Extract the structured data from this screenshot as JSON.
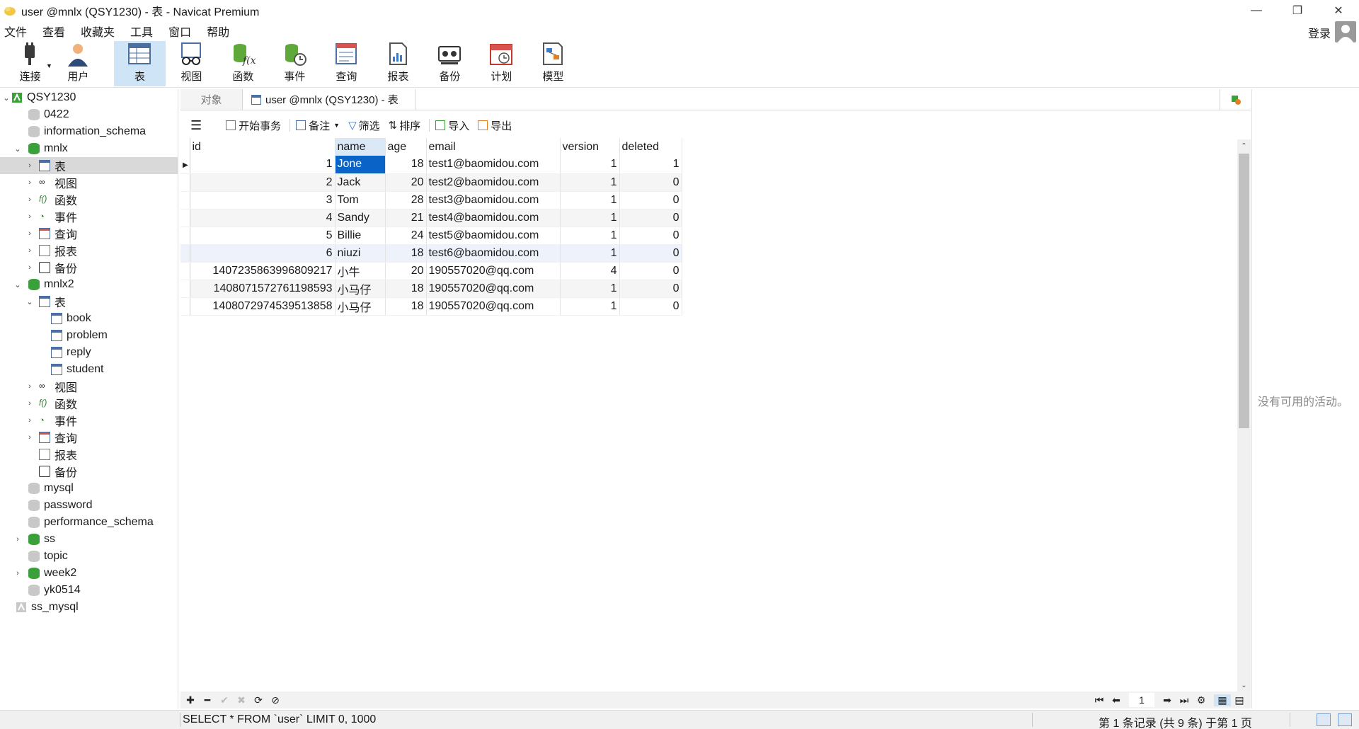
{
  "window": {
    "title": "user @mnlx (QSY1230) - 表 - Navicat Premium",
    "minimize": "—",
    "maximize": "❐",
    "close": "✕"
  },
  "menu": [
    "文件",
    "查看",
    "收藏夹",
    "工具",
    "窗口",
    "帮助"
  ],
  "account": {
    "login": "登录"
  },
  "toolbar": {
    "connect": "连接",
    "user": "用户",
    "table": "表",
    "view": "视图",
    "function": "函数",
    "event": "事件",
    "query": "查询",
    "report": "报表",
    "backup": "备份",
    "schedule": "计划",
    "model": "模型"
  },
  "tree": {
    "connection": "QSY1230",
    "db_0422": "0422",
    "db_information_schema": "information_schema",
    "db_mnlx": "mnlx",
    "mnlx_tables": "表",
    "mnlx_views": "视图",
    "mnlx_functions": "函数",
    "mnlx_events": "事件",
    "mnlx_queries": "查询",
    "mnlx_reports": "报表",
    "mnlx_backups": "备份",
    "db_mnlx2": "mnlx2",
    "mnlx2_tables": "表",
    "t_book": "book",
    "t_problem": "problem",
    "t_reply": "reply",
    "t_student": "student",
    "mnlx2_views": "视图",
    "mnlx2_functions": "函数",
    "mnlx2_events": "事件",
    "mnlx2_queries": "查询",
    "mnlx2_reports": "报表",
    "mnlx2_backups": "备份",
    "db_mysql": "mysql",
    "db_password": "password",
    "db_performance_schema": "performance_schema",
    "db_ss": "ss",
    "db_topic": "topic",
    "db_week2": "week2",
    "db_yk0514": "yk0514",
    "connection2": "ss_mysql"
  },
  "tabs": {
    "objects": "对象",
    "active": "user @mnlx (QSY1230) - 表"
  },
  "data_toolbar": {
    "begin_tx": "开始事务",
    "note": "备注",
    "filter": "筛选",
    "sort": "排序",
    "import": "导入",
    "export": "导出"
  },
  "grid": {
    "columns": [
      "id",
      "name",
      "age",
      "email",
      "version",
      "deleted"
    ],
    "rows": [
      [
        "1",
        "Jone",
        "18",
        "test1@baomidou.com",
        "1",
        "1"
      ],
      [
        "2",
        "Jack",
        "20",
        "test2@baomidou.com",
        "1",
        "0"
      ],
      [
        "3",
        "Tom",
        "28",
        "test3@baomidou.com",
        "1",
        "0"
      ],
      [
        "4",
        "Sandy",
        "21",
        "test4@baomidou.com",
        "1",
        "0"
      ],
      [
        "5",
        "Billie",
        "24",
        "test5@baomidou.com",
        "1",
        "0"
      ],
      [
        "6",
        "niuzi",
        "18",
        "test6@baomidou.com",
        "1",
        "0"
      ],
      [
        "1407235863996809217",
        "小牛",
        "20",
        "190557020@qq.com",
        "4",
        "0"
      ],
      [
        "1408071572761198593",
        "小马仔",
        "18",
        "190557020@qq.com",
        "1",
        "0"
      ],
      [
        "1408072974539513858",
        "小马仔",
        "18",
        "190557020@qq.com",
        "1",
        "0"
      ]
    ]
  },
  "info_panel": {
    "text": "没有可用的活动。"
  },
  "pager": {
    "page": "1"
  },
  "status": {
    "sql": "SELECT * FROM `user` LIMIT 0, 1000",
    "records": "第 1 条记录 (共 9 条) 于第 1 页"
  },
  "colors": {
    "accent": "#0a64c8",
    "toolbar_active": "#cfe4f7",
    "db_green": "#3aa13a"
  }
}
